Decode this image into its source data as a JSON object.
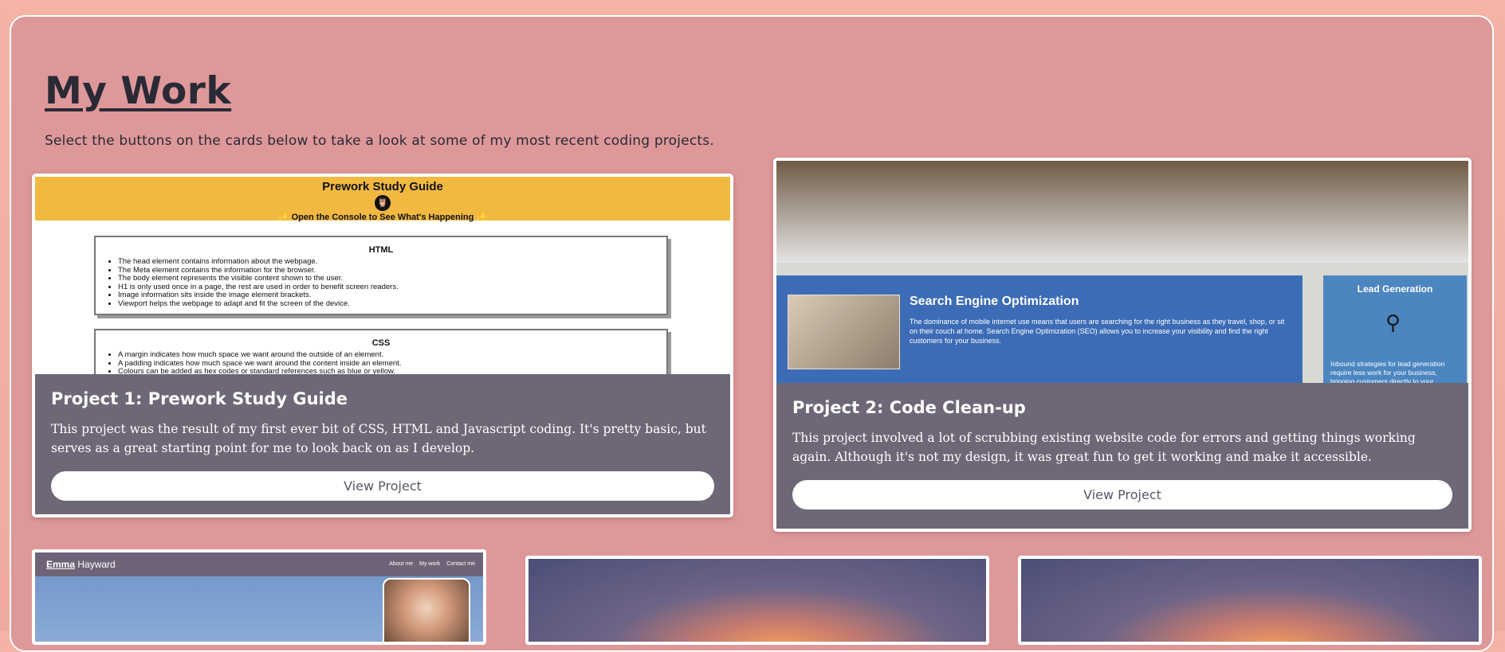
{
  "heading": "My Work",
  "intro": "Select the buttons on the cards below to take a look at some of my most recent coding projects.",
  "projects": [
    {
      "title": "Project 1: Prework Study Guide",
      "description": "This project was the result of my first ever bit of CSS, HTML and Javascript coding. It's pretty basic, but serves as a great starting point for me to look back on as I develop.",
      "button": "View Project",
      "preview": {
        "title": "Prework Study Guide",
        "console": "✨ Open the Console to See What's Happening ✨",
        "owl_glyph": "🦉",
        "sections": [
          {
            "heading": "HTML",
            "items": [
              "The head element contains information about the webpage.",
              "The Meta element contains the information for the browser.",
              "The body element represents the visible content shown to the user.",
              "H1 is only used once in a page, the rest are used in order to benefit screen readers.",
              "Image information sits inside the image element brackets.",
              "Viewport helps the webpage to adapt and fit the screen of the device."
            ]
          },
          {
            "heading": "CSS",
            "items": [
              "A margin indicates how much space we want around the outside of an element.",
              "A padding indicates how much space we want around the content inside an element.",
              "Colours can be added as hex codes or standard references such as blue or yellow."
            ]
          }
        ]
      }
    },
    {
      "title": "Project 2: Code Clean-up",
      "description": "This project involved a lot of scrubbing existing website code for errors and getting things working again. Although it's not my design, it was great fun to get it working and make it accessible.",
      "button": "View Project",
      "preview": {
        "seo_title": "Search Engine Optimization",
        "seo_text": "The dominance of mobile internet use means that users are searching for the right business as they travel, shop, or sit on their couch at home. Search Engine Optimization (SEO) allows you to increase your visibility and find the right customers for your business.",
        "lead_title": "Lead Generation",
        "lead_text": "Inbound strategies for lead generation require less work for your business, bringing customers directly to your"
      }
    }
  ],
  "portfolio_preview": {
    "brand_first": "Emma",
    "brand_last": " Hayward",
    "nav": [
      "About me",
      "My work",
      "Contact me"
    ]
  }
}
